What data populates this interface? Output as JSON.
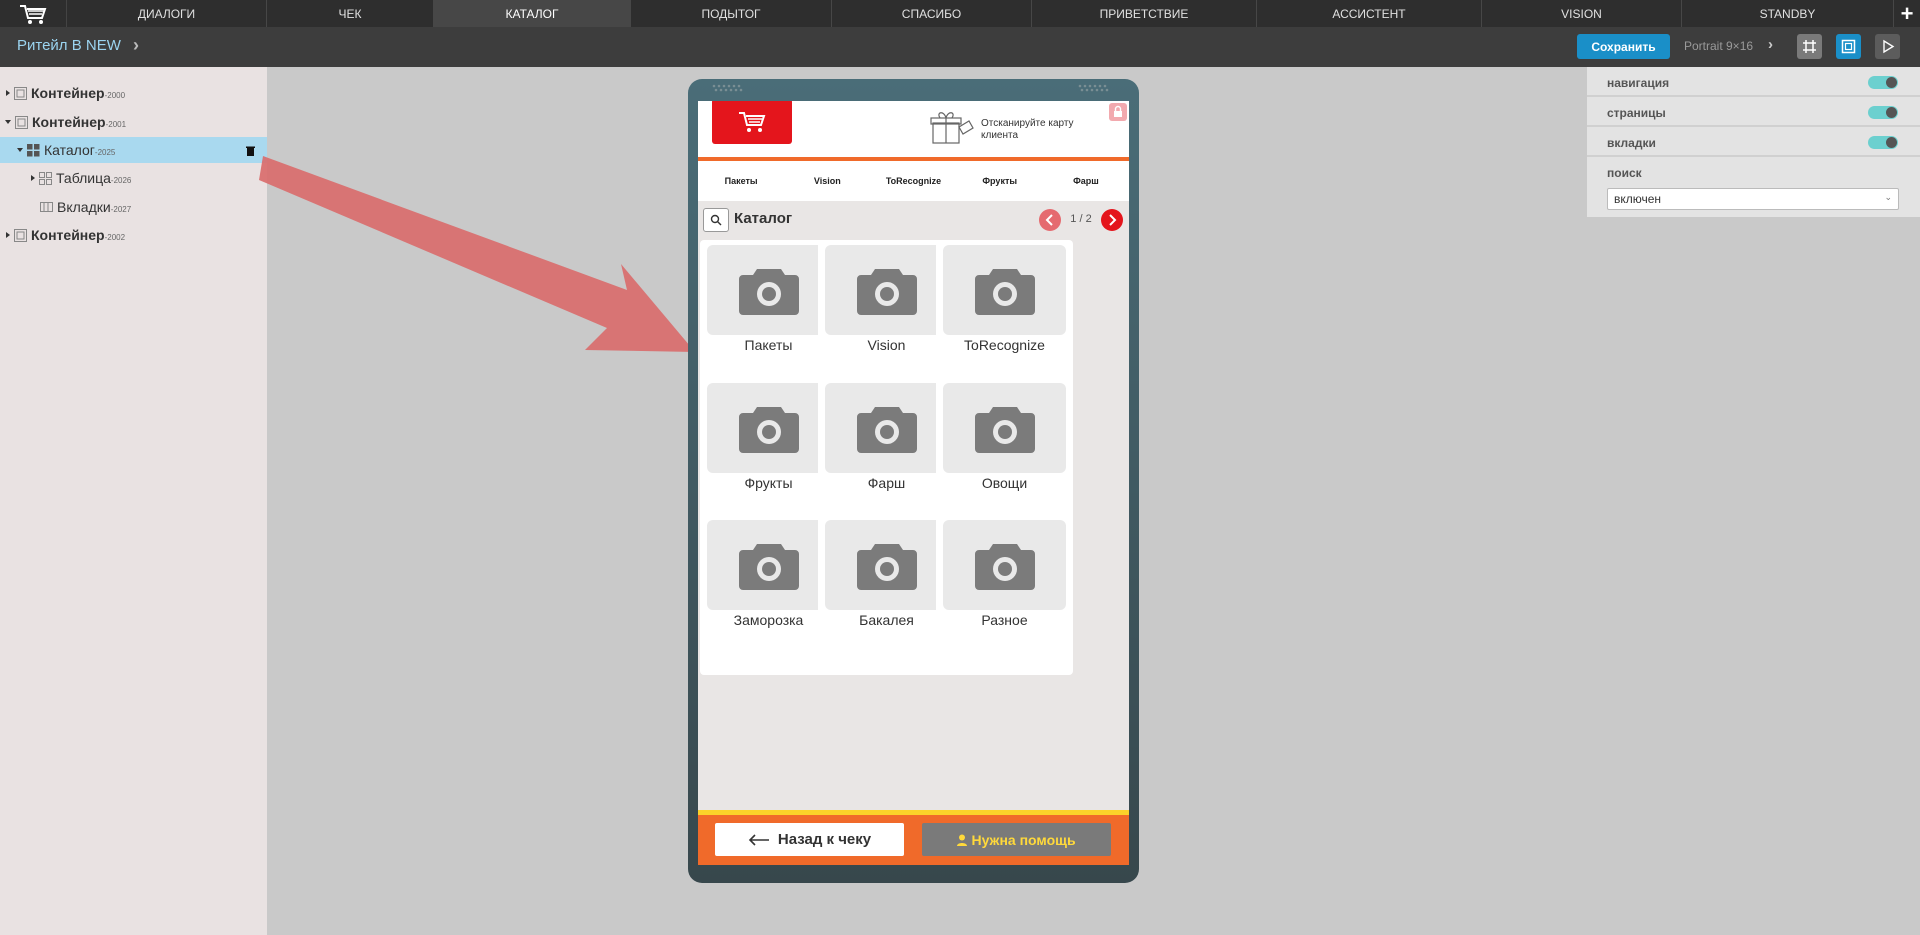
{
  "top_tabs": [
    {
      "label": "ДИАЛОГИ"
    },
    {
      "label": "ЧЕК"
    },
    {
      "label": "КАТАЛОГ"
    },
    {
      "label": "ПОДЫТОГ"
    },
    {
      "label": "СПАСИБО"
    },
    {
      "label": "ПРИВЕТСТВИЕ"
    },
    {
      "label": "АССИСТЕНТ"
    },
    {
      "label": "VISION"
    },
    {
      "label": "STANDBY"
    }
  ],
  "active_tab": "КАТАЛОГ",
  "add_tab_label": "+",
  "toolbar": {
    "project_name": "Ритейл B NEW",
    "save_label": "Сохранить",
    "orientation_label": "Portrait 9×16"
  },
  "tree": [
    {
      "label": "Контейнер",
      "id": "-2000"
    },
    {
      "label": "Контейнер",
      "id": "-2001"
    },
    {
      "label": "Каталог",
      "id": "-2025"
    },
    {
      "label": "Таблица",
      "id": "-2026"
    },
    {
      "label": "Вкладки",
      "id": "-2027"
    },
    {
      "label": "Контейнер",
      "id": "-2002"
    }
  ],
  "props": {
    "navigation": {
      "label": "навигация",
      "enabled": true
    },
    "pages": {
      "label": "страницы",
      "enabled": true
    },
    "tabs": {
      "label": "вкладки",
      "enabled": true
    },
    "search": {
      "label": "поиск",
      "value": "включен"
    }
  },
  "phone": {
    "scan_text": "Отсканируйте карту клиента",
    "category_tabs": [
      "Пакеты",
      "Vision",
      "ToRecognize",
      "Фрукты",
      "Фарш"
    ],
    "catalog_title": "Каталог",
    "pagination": "1 / 2",
    "cards": [
      "Пакеты",
      "Vision",
      "ToRecognize",
      "Фрукты",
      "Фарш",
      "Овощи",
      "Заморозка",
      "Бакалея",
      "Разное"
    ],
    "back_label": "Назад к чеку",
    "help_label": "Нужна помощь"
  },
  "colors": {
    "accent_blue": "#1a8fc8",
    "brand_red": "#e4151c",
    "brand_orange": "#f06a2a",
    "toggle_teal": "#6cd0cf",
    "tree_selection": "#a9d9ef"
  }
}
